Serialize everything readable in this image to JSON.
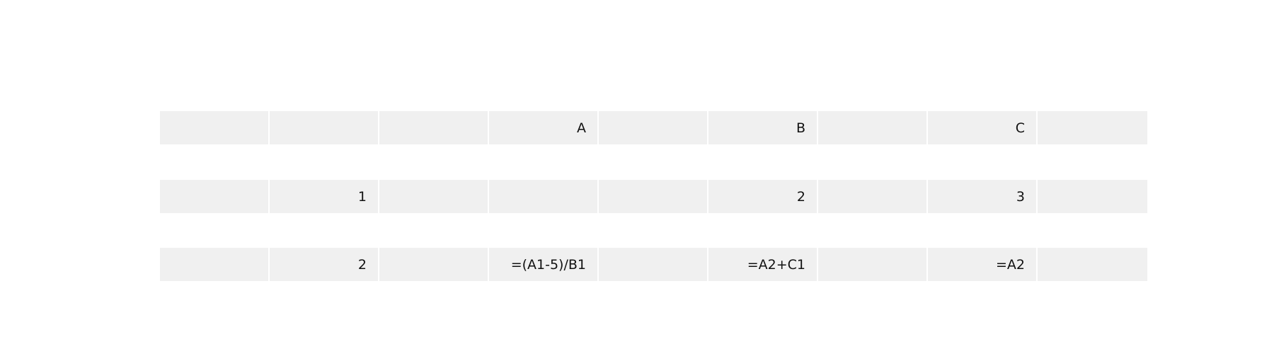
{
  "sheet": {
    "rows": [
      [
        "",
        "",
        "",
        "A",
        "",
        "B",
        "",
        "C",
        ""
      ],
      [
        "",
        "1",
        "",
        "",
        "",
        "2",
        "",
        "3",
        ""
      ],
      [
        "",
        "2",
        "",
        "=(A1-5)/B1",
        "",
        "=A2+C1",
        "",
        "=A2",
        ""
      ]
    ]
  },
  "colors": {
    "cell_background": "#f0f0f0",
    "cell_separator": "#ffffff",
    "text": "#111111",
    "page_background": "#ffffff"
  }
}
